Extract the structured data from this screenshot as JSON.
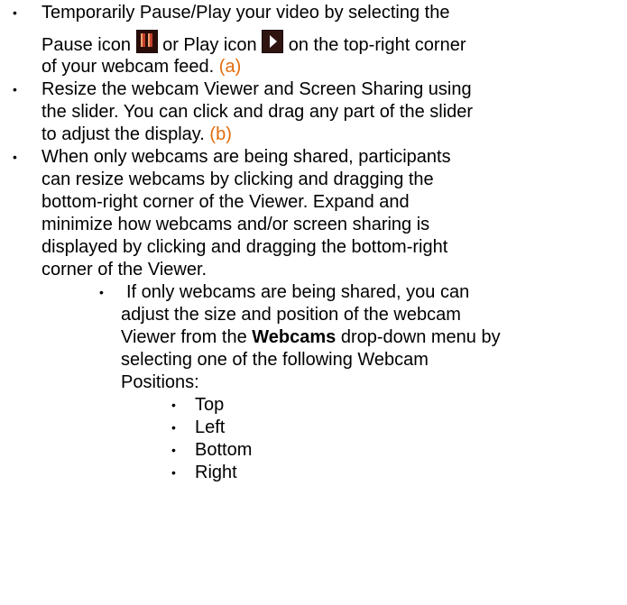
{
  "bullets": {
    "symbol": "•"
  },
  "item1": {
    "line1": "Temporarily Pause/Play your video by selecting the",
    "line2_a": "Pause icon",
    "line2_b": "or Play icon",
    "line2_c": "on the top-right corner",
    "line3_text": "of your webcam feed.",
    "line3_ref": "(a)",
    "pause_icon": "pause-icon",
    "play_icon": "play-icon"
  },
  "item2": {
    "line1": "Resize the webcam Viewer and Screen Sharing using",
    "line2": "the slider. You can click and drag any part of the slider",
    "line3_text": "to adjust the display.",
    "line3_ref": "(b)"
  },
  "item3": {
    "line1": "When only webcams are being shared, participants",
    "line2": "can resize webcams by clicking and dragging the",
    "line3": "bottom-right corner of the Viewer. Expand and",
    "line4": "minimize how webcams and/or screen sharing is",
    "line5": "displayed by clicking and dragging the bottom-right",
    "line6": "corner of the Viewer."
  },
  "item4": {
    "line1": "If only webcams are being shared, you can",
    "line2": "adjust the size and position of the webcam",
    "line3_a": "Viewer from the",
    "line3_bold": "Webcams",
    "line3_b": "drop-down menu by",
    "line4": "selecting one of the following Webcam",
    "line5": "Positions:"
  },
  "positions": [
    "Top",
    "Left",
    "Bottom",
    "Right"
  ],
  "colors": {
    "reference": "#e36c0a",
    "icon_bg": "#1a0a0a",
    "icon_glyph_pause": "#c04028",
    "icon_glyph_play": "#ffffff"
  }
}
